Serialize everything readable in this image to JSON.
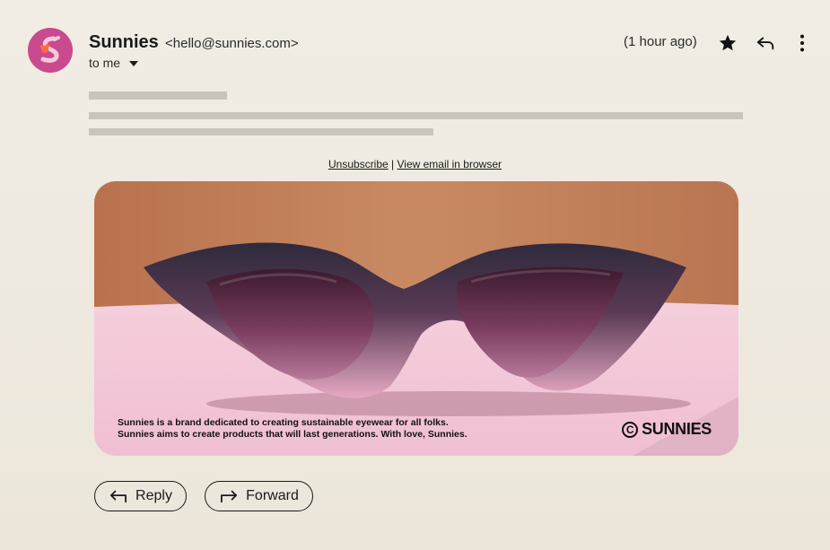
{
  "sender": {
    "name": "Sunnies",
    "email": "<hello@sunnies.com>",
    "recipient_label": "to me",
    "avatar_icon": "sunnies-logo-icon",
    "avatar_color": "#c94a8e"
  },
  "timestamp": "(1 hour ago)",
  "toolbar": {
    "star_icon": "star-icon",
    "reply_icon": "reply-icon",
    "more_icon": "more-vertical-icon"
  },
  "email_body": {
    "unsubscribe_label": "Unsubscribe",
    "separator": " | ",
    "view_in_browser_label": "View email in  browser",
    "hero_copy_line1": "Sunnies is a brand dedicated to creating sustainable eyewear for all folks.",
    "hero_copy_line2": "Sunnies aims to create products that will last generations. With love, Sunnies.",
    "hero_logo_mark": "C",
    "hero_logo_text": "SUNNIES"
  },
  "actions": {
    "reply_label": "Reply",
    "forward_label": "Forward"
  },
  "colors": {
    "accent": "#c94a8e",
    "background": "#f1ede5",
    "hero_wall": "#c4805a",
    "hero_table": "#f2c6d6"
  }
}
